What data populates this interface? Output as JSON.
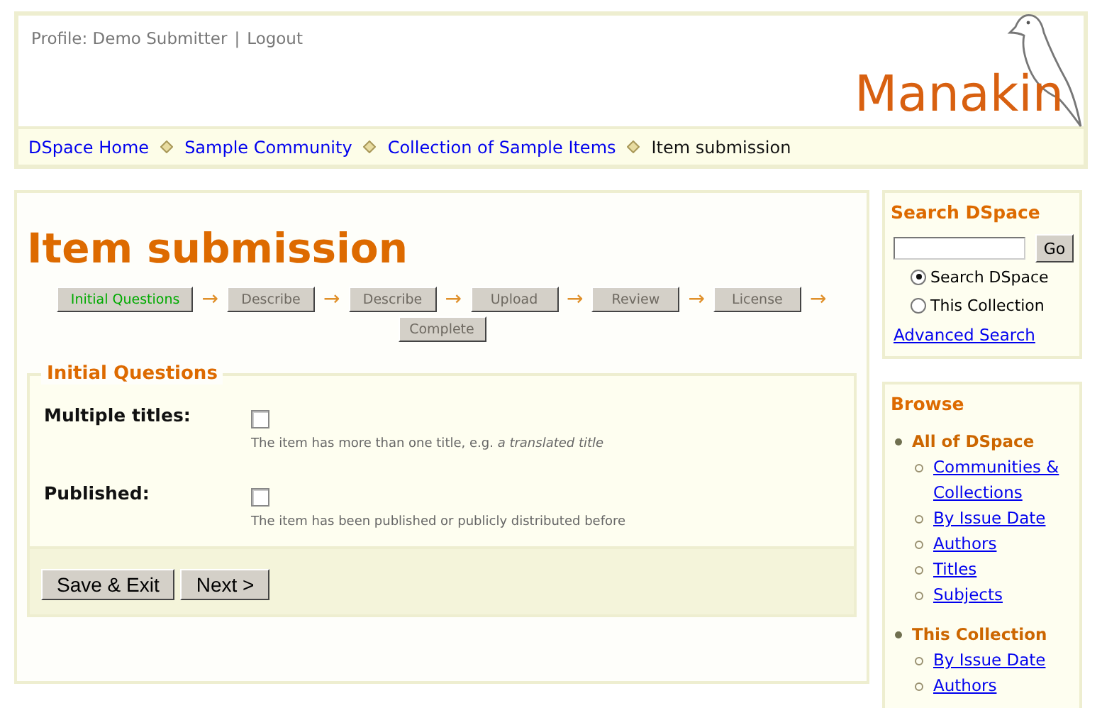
{
  "header": {
    "profile": "Profile: Demo Submitter",
    "separator": "|",
    "logout": "Logout",
    "logo": "Manakin"
  },
  "breadcrumbs": [
    {
      "label": "DSpace Home",
      "link": true
    },
    {
      "label": "Sample Community",
      "link": true
    },
    {
      "label": "Collection of Sample Items",
      "link": true
    },
    {
      "label": "Item submission",
      "link": false
    }
  ],
  "main": {
    "title": "Item submission",
    "steps": [
      {
        "label": "Initial Questions",
        "selected": true,
        "arrow": "→"
      },
      {
        "label": "Describe",
        "selected": false,
        "arrow": "→"
      },
      {
        "label": "Describe",
        "selected": false,
        "arrow": "→"
      },
      {
        "label": "Upload",
        "selected": false,
        "arrow": "→"
      },
      {
        "label": "Review",
        "selected": false,
        "arrow": "→"
      },
      {
        "label": "License",
        "selected": false,
        "arrow": "→"
      },
      {
        "label": "Complete",
        "selected": false
      }
    ],
    "section": "Initial Questions",
    "questions": [
      {
        "label": "Multiple titles:",
        "checked": false,
        "help": "The item has more than one title, e.g. *a translated title*"
      },
      {
        "label": "Published:",
        "checked": false,
        "help": "The item has been published or publicly distributed before"
      }
    ],
    "buttons": [
      "Save & Exit",
      "Next >"
    ]
  },
  "sidebar": {
    "search": {
      "title": "Search DSpace",
      "go": "Go",
      "scopes": [
        {
          "label": "Search DSpace",
          "selected": true
        },
        {
          "label": "This Collection",
          "selected": false
        }
      ],
      "advanced": "Advanced Search"
    },
    "browse": {
      "title": "Browse",
      "groups": [
        {
          "label": "All of DSpace",
          "children": [
            {
              "label": "Communities & Collections"
            },
            {
              "label": "By Issue Date"
            },
            {
              "label": "Authors"
            },
            {
              "label": "Titles"
            },
            {
              "label": "Subjects"
            }
          ]
        },
        {
          "label": "This Collection",
          "children": [
            {
              "label": "By Issue Date"
            },
            {
              "label": "Authors"
            }
          ]
        }
      ]
    }
  }
}
